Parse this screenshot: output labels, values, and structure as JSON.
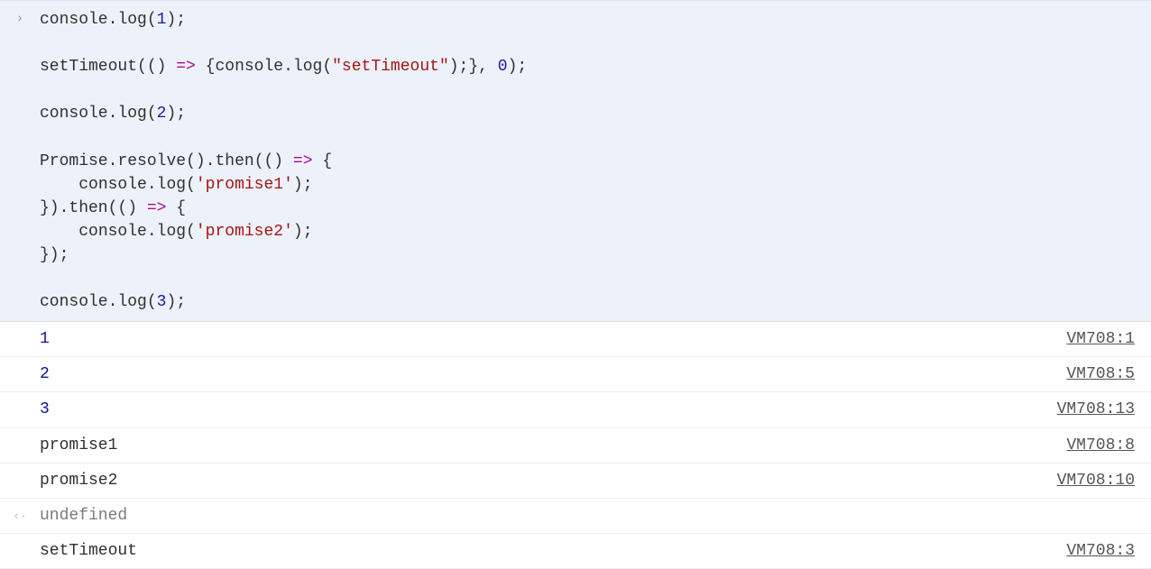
{
  "input": {
    "prompt_icon": "›",
    "code_lines": [
      {
        "segments": [
          {
            "t": "console",
            "c": "tok-obj"
          },
          {
            "t": ".",
            "c": "tok-op"
          },
          {
            "t": "log",
            "c": "tok-func"
          },
          {
            "t": "(",
            "c": "tok-op"
          },
          {
            "t": "1",
            "c": "tok-num"
          },
          {
            "t": ");",
            "c": "tok-op"
          }
        ]
      },
      {
        "segments": []
      },
      {
        "segments": [
          {
            "t": "setTimeout",
            "c": "tok-func"
          },
          {
            "t": "(() ",
            "c": "tok-op"
          },
          {
            "t": "=>",
            "c": "tok-key"
          },
          {
            "t": " {",
            "c": "tok-op"
          },
          {
            "t": "console",
            "c": "tok-obj"
          },
          {
            "t": ".",
            "c": "tok-op"
          },
          {
            "t": "log",
            "c": "tok-func"
          },
          {
            "t": "(",
            "c": "tok-op"
          },
          {
            "t": "\"setTimeout\"",
            "c": "tok-str"
          },
          {
            "t": ");}, ",
            "c": "tok-op"
          },
          {
            "t": "0",
            "c": "tok-num"
          },
          {
            "t": ");",
            "c": "tok-op"
          }
        ]
      },
      {
        "segments": []
      },
      {
        "segments": [
          {
            "t": "console",
            "c": "tok-obj"
          },
          {
            "t": ".",
            "c": "tok-op"
          },
          {
            "t": "log",
            "c": "tok-func"
          },
          {
            "t": "(",
            "c": "tok-op"
          },
          {
            "t": "2",
            "c": "tok-num"
          },
          {
            "t": ");",
            "c": "tok-op"
          }
        ]
      },
      {
        "segments": []
      },
      {
        "segments": [
          {
            "t": "Promise",
            "c": "tok-obj"
          },
          {
            "t": ".",
            "c": "tok-op"
          },
          {
            "t": "resolve",
            "c": "tok-func"
          },
          {
            "t": "().",
            "c": "tok-op"
          },
          {
            "t": "then",
            "c": "tok-func"
          },
          {
            "t": "(() ",
            "c": "tok-op"
          },
          {
            "t": "=>",
            "c": "tok-key"
          },
          {
            "t": " {",
            "c": "tok-op"
          }
        ]
      },
      {
        "segments": [
          {
            "t": "    ",
            "c": "tok-op"
          },
          {
            "t": "console",
            "c": "tok-obj"
          },
          {
            "t": ".",
            "c": "tok-op"
          },
          {
            "t": "log",
            "c": "tok-func"
          },
          {
            "t": "(",
            "c": "tok-op"
          },
          {
            "t": "'promise1'",
            "c": "tok-str"
          },
          {
            "t": ");",
            "c": "tok-op"
          }
        ]
      },
      {
        "segments": [
          {
            "t": "}).",
            "c": "tok-op"
          },
          {
            "t": "then",
            "c": "tok-func"
          },
          {
            "t": "(() ",
            "c": "tok-op"
          },
          {
            "t": "=>",
            "c": "tok-key"
          },
          {
            "t": " {",
            "c": "tok-op"
          }
        ]
      },
      {
        "segments": [
          {
            "t": "    ",
            "c": "tok-op"
          },
          {
            "t": "console",
            "c": "tok-obj"
          },
          {
            "t": ".",
            "c": "tok-op"
          },
          {
            "t": "log",
            "c": "tok-func"
          },
          {
            "t": "(",
            "c": "tok-op"
          },
          {
            "t": "'promise2'",
            "c": "tok-str"
          },
          {
            "t": ");",
            "c": "tok-op"
          }
        ]
      },
      {
        "segments": [
          {
            "t": "});",
            "c": "tok-op"
          }
        ]
      },
      {
        "segments": []
      },
      {
        "segments": [
          {
            "t": "console",
            "c": "tok-obj"
          },
          {
            "t": ".",
            "c": "tok-op"
          },
          {
            "t": "log",
            "c": "tok-func"
          },
          {
            "t": "(",
            "c": "tok-op"
          },
          {
            "t": "3",
            "c": "tok-num"
          },
          {
            "t": ");",
            "c": "tok-op"
          }
        ]
      }
    ]
  },
  "output": [
    {
      "type": "log",
      "msg": "1",
      "msg_class": "msg-num",
      "src": "VM708:1",
      "gutter": ""
    },
    {
      "type": "log",
      "msg": "2",
      "msg_class": "msg-num",
      "src": "VM708:5",
      "gutter": ""
    },
    {
      "type": "log",
      "msg": "3",
      "msg_class": "msg-num",
      "src": "VM708:13",
      "gutter": ""
    },
    {
      "type": "log",
      "msg": "promise1",
      "msg_class": "msg-str",
      "src": "VM708:8",
      "gutter": ""
    },
    {
      "type": "log",
      "msg": "promise2",
      "msg_class": "msg-str",
      "src": "VM708:10",
      "gutter": ""
    },
    {
      "type": "return",
      "msg": "undefined",
      "msg_class": "msg-undef",
      "src": "",
      "gutter": "‹·"
    },
    {
      "type": "log",
      "msg": "setTimeout",
      "msg_class": "msg-str",
      "src": "VM708:3",
      "gutter": ""
    }
  ]
}
